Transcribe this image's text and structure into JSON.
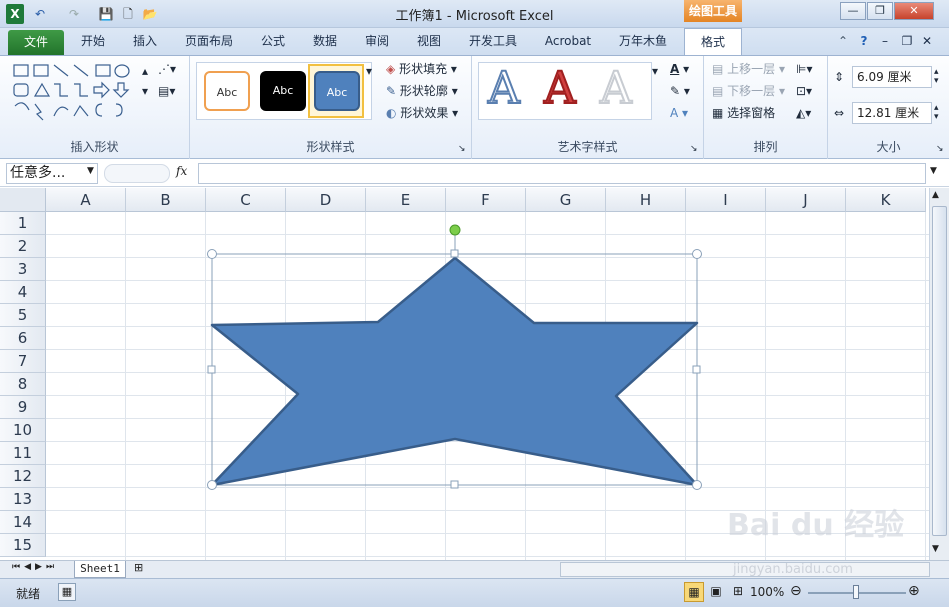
{
  "window": {
    "title": "工作簿1 - Microsoft Excel",
    "context_tab": "绘图工具"
  },
  "qat": {
    "app_icon": "X",
    "undo": "↶",
    "redo": "↷",
    "save": "💾",
    "new": "🗋",
    "open": "📂"
  },
  "window_controls": {
    "minimize": "—",
    "restore": "❐",
    "close": "✕"
  },
  "tabs": [
    "文件",
    "开始",
    "插入",
    "页面布局",
    "公式",
    "数据",
    "审阅",
    "视图",
    "开发工具",
    "Acrobat",
    "万年木鱼",
    "格式"
  ],
  "ribbon": {
    "insert_shapes": {
      "label": "插入形状"
    },
    "shape_styles": {
      "label": "形状样式",
      "style1": "Abc",
      "style2": "Abc",
      "style3": "Abc",
      "fill": "形状填充",
      "outline": "形状轮廓",
      "effects": "形状效果"
    },
    "wordart": {
      "label": "艺术字样式",
      "letter1": "A",
      "letter2": "A",
      "letter3": "A"
    },
    "arrange": {
      "label": "排列",
      "bring_forward": "上移一层",
      "send_backward": "下移一层",
      "selection_pane": "选择窗格"
    },
    "size": {
      "label": "大小",
      "height": "6.09 厘米",
      "width": "12.81 厘米"
    }
  },
  "formula_bar": {
    "name_box": "任意多...",
    "fx": "fx",
    "value": ""
  },
  "columns": [
    "A",
    "B",
    "C",
    "D",
    "E",
    "F",
    "G",
    "H",
    "I",
    "J",
    "K"
  ],
  "rows": [
    "1",
    "2",
    "3",
    "4",
    "5",
    "6",
    "7",
    "8",
    "9",
    "10",
    "11",
    "12",
    "13",
    "14",
    "15"
  ],
  "sheet": {
    "tab": "Sheet1"
  },
  "status": {
    "ready": "就绪",
    "zoom": "100%"
  },
  "watermark": {
    "text": "Bai du 经验",
    "url": "jingyan.baidu.com"
  },
  "colors": {
    "shape_fill": "#4f81bd",
    "shape_stroke": "#385d8a",
    "file_tab": "#2a7d32",
    "context_tab": "#e8902f"
  }
}
